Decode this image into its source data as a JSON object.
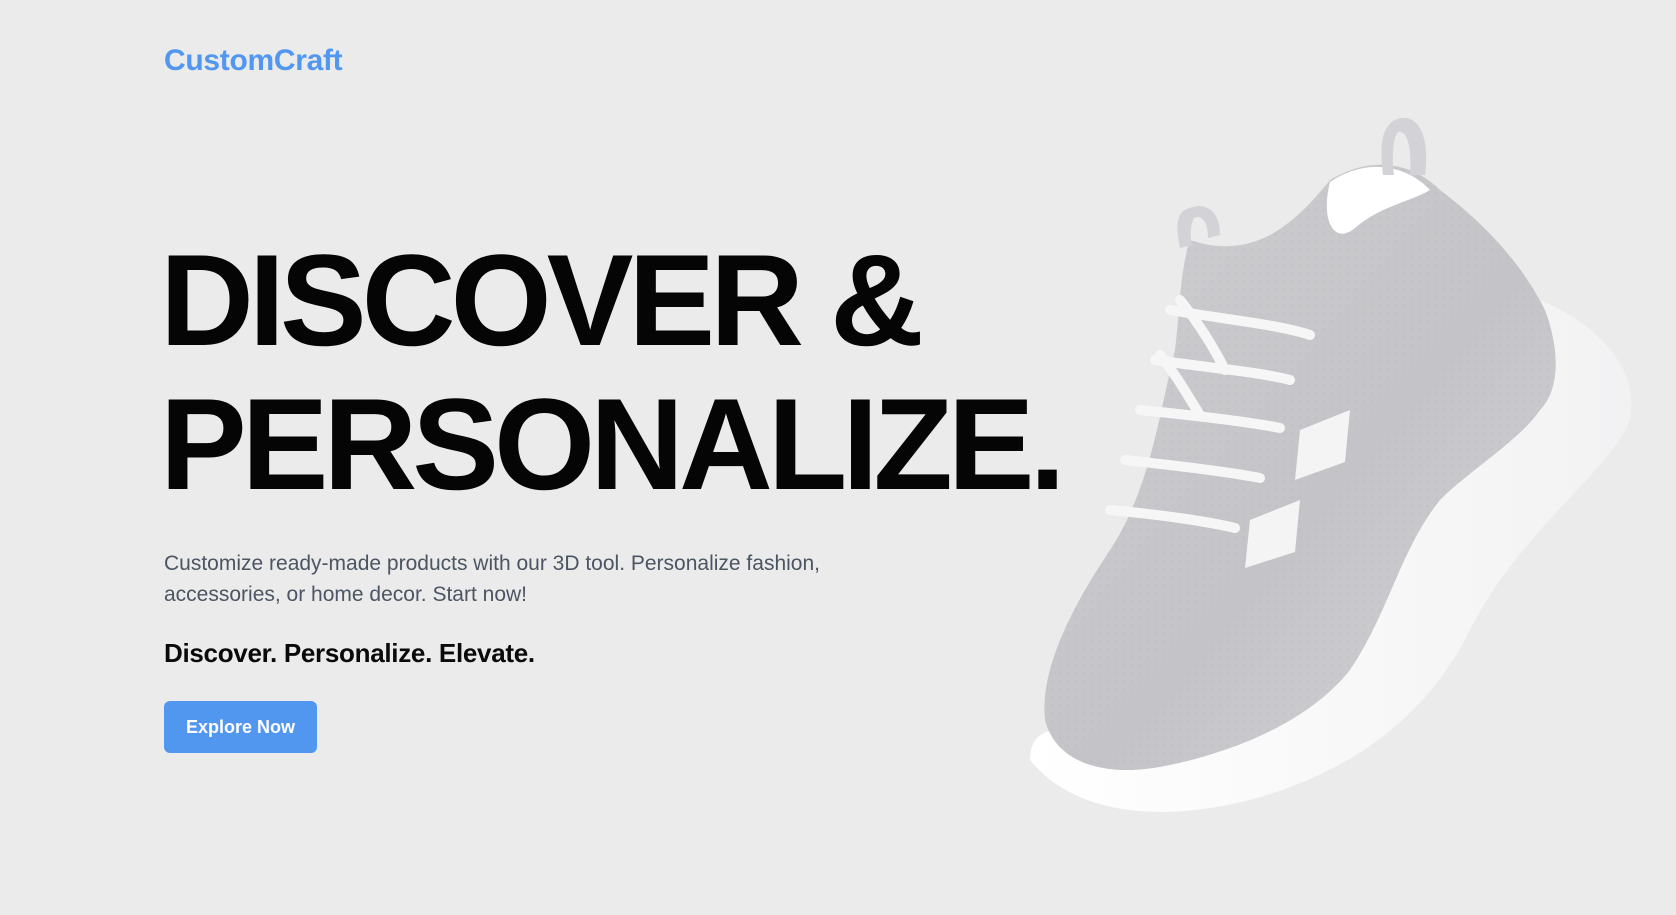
{
  "brand": {
    "name": "CustomCraft"
  },
  "hero": {
    "headline_line1": "DISCOVER &",
    "headline_line2": "PERSONALIZE.",
    "description": "Customize ready-made products with our 3D tool. Personalize fashion, accessories, or home decor. Start now!",
    "tagline": "Discover. Personalize. Elevate.",
    "cta_label": "Explore Now"
  },
  "colors": {
    "background": "#ebebeb",
    "accent": "#5197f0",
    "headline": "#050505",
    "body_text": "#4b5563"
  },
  "images": {
    "product": "sneaker-3d-render"
  }
}
